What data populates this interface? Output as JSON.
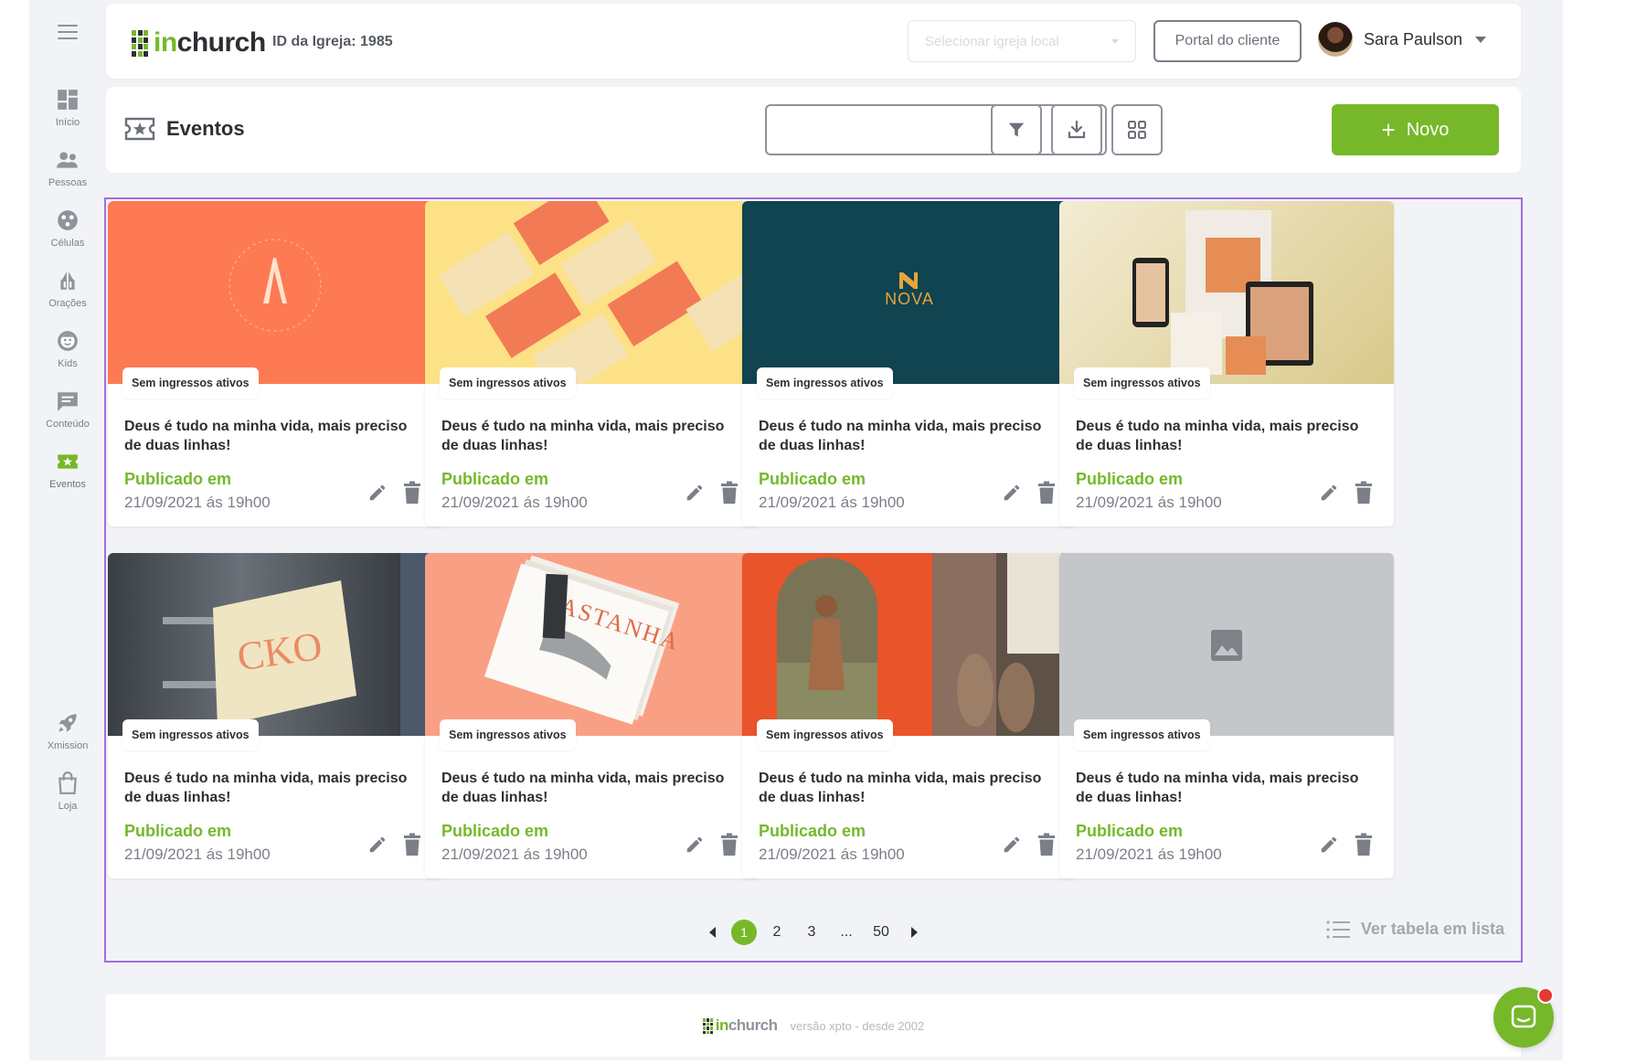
{
  "sidebar": {
    "items": [
      {
        "label": "Início",
        "icon": "dashboard-icon"
      },
      {
        "label": "Pessoas",
        "icon": "people-icon"
      },
      {
        "label": "Células",
        "icon": "cells-icon"
      },
      {
        "label": "Orações",
        "icon": "praying-hands-icon"
      },
      {
        "label": "Kids",
        "icon": "kids-face-icon"
      },
      {
        "label": "Conteúdo",
        "icon": "content-chat-icon"
      },
      {
        "label": "Eventos",
        "icon": "ticket-star-icon",
        "active": true
      },
      {
        "label": "Xmission",
        "icon": "rocket-icon"
      },
      {
        "label": "Loja",
        "icon": "shopping-bag-icon"
      }
    ]
  },
  "header": {
    "logo_prefix": "in",
    "logo_suffix": "church",
    "church_id": "ID da Igreja: 1985",
    "select_placeholder": "Selecionar igreja local",
    "portal_label": "Portal do cliente",
    "user_name": "Sara Paulson"
  },
  "page": {
    "title": "Eventos",
    "search_value": "",
    "new_label": "Novo"
  },
  "cards": [
    {
      "badge": "Sem ingressos ativos",
      "title": "Deus é tudo na minha vida, mais preciso de duas linhas!",
      "published_label": "Publicado em",
      "date": "21/09/2021 ás 19h00",
      "cover": "coral-moon-logo"
    },
    {
      "badge": "Sem ingressos ativos",
      "title": "Deus é tudo na minha vida, mais preciso de duas linhas!",
      "published_label": "Publicado em",
      "date": "21/09/2021 ás 19h00",
      "cover": "yellow-business-cards"
    },
    {
      "badge": "Sem ingressos ativos",
      "title": "Deus é tudo na minha vida, mais preciso de duas linhas!",
      "published_label": "Publicado em",
      "date": "21/09/2021 ás 19h00",
      "cover": "nova-teal-logo",
      "cover_text": "NOVA"
    },
    {
      "badge": "Sem ingressos ativos",
      "title": "Deus é tudo na minha vida, mais preciso de duas linhas!",
      "published_label": "Publicado em",
      "date": "21/09/2021 ás 19h00",
      "cover": "fashion-devices-mockup"
    },
    {
      "badge": "Sem ingressos ativos",
      "title": "Deus é tudo na minha vida, mais preciso de duas linhas!",
      "published_label": "Publicado em",
      "date": "21/09/2021 ás 19h00",
      "cover": "cko-store-sign",
      "cover_text": "CKO"
    },
    {
      "badge": "Sem ingressos ativos",
      "title": "Deus é tudo na minha vida, mais preciso de duas linhas!",
      "published_label": "Publicado em",
      "date": "21/09/2021 ás 19h00",
      "cover": "castanha-magazine",
      "cover_text": "CASTANHA"
    },
    {
      "badge": "Sem ingressos ativos",
      "title": "Deus é tudo na minha vida, mais preciso de duas linhas!",
      "published_label": "Publicado em",
      "date": "21/09/2021 ás 19h00",
      "cover": "fashion-photos"
    },
    {
      "badge": "Sem ingressos ativos",
      "title": "Deus é tudo na minha vida, mais preciso de duas linhas!",
      "published_label": "Publicado em",
      "date": "21/09/2021 ás 19h00",
      "cover": "image-placeholder"
    }
  ],
  "pagination": {
    "pages": [
      "1",
      "2",
      "3",
      "...",
      "50"
    ],
    "current": "1",
    "list_view_label": "Ver tabela em lista"
  },
  "footer": {
    "version": "versão xpto - desde 2002"
  },
  "colors": {
    "brand_green": "#76b82a",
    "selection_border": "#a06ee0",
    "notification": "#e53935"
  }
}
